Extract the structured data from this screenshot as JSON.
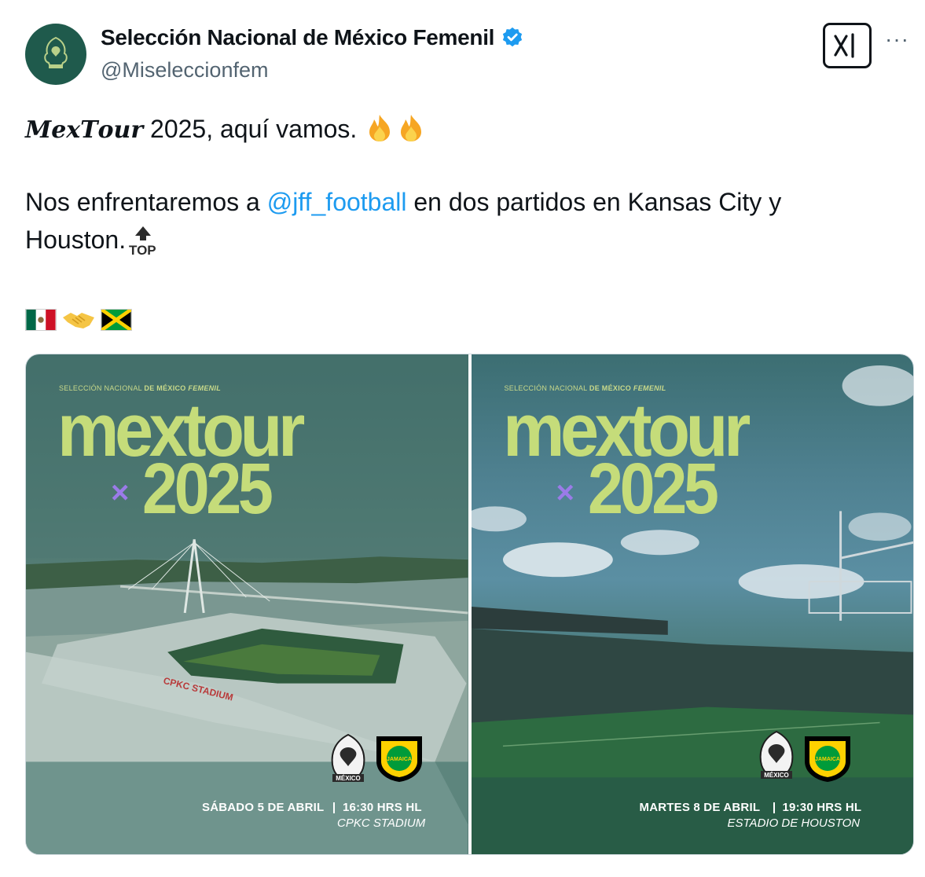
{
  "author": {
    "display_name": "Selección Nacional de México Femenil",
    "handle": "@Miseleccionfem",
    "verified": true,
    "avatar_icon": "mexico-federation-crest-icon"
  },
  "actions": {
    "grok_icon": "xai-grok-icon",
    "more_label": "···"
  },
  "tweet": {
    "line1_fancy": "𝑴𝒆𝒙𝑻𝒐𝒖𝒓",
    "line1_rest": " 2025, aquí vamos. ",
    "line2_before": "Nos enfrentaremos a ",
    "line2_mention": "@jff_football",
    "line2_after": " en dos partidos en Kansas City y",
    "line3": "Houston.",
    "emoji_line": [
      "mexico-flag-icon",
      "handshake-icon",
      "jamaica-flag-icon"
    ]
  },
  "media": {
    "cards": [
      {
        "kicker_prefix": "SELECCIÓN NACIONAL ",
        "kicker_bold": "DE MÉXICO ",
        "kicker_italic": "FEMENIL",
        "title": "mextour",
        "year": "2025",
        "x_mark": "×",
        "date": "SÁBADO 5 DE ABRIL",
        "time": "16:30 HRS HL",
        "venue": "CPKC STADIUM",
        "stadium_sign": "CPKC STADIUM",
        "crest_mx_label": "MÉXICO",
        "crest_jam_label": "JAMAICA"
      },
      {
        "kicker_prefix": "SELECCIÓN NACIONAL ",
        "kicker_bold": "DE MÉXICO ",
        "kicker_italic": "FEMENIL",
        "title": "mextour",
        "year": "2025",
        "x_mark": "×",
        "date": "MARTES 8 DE ABRIL",
        "time": "19:30 HRS HL",
        "venue": "ESTADIO DE HOUSTON",
        "crest_mx_label": "MÉXICO",
        "crest_jam_label": "JAMAICA"
      }
    ]
  },
  "colors": {
    "accent_title": "#c5dc7a",
    "x_mark": "#9b7be8",
    "mention": "#1d9bf0",
    "verified": "#1d9bf0"
  }
}
